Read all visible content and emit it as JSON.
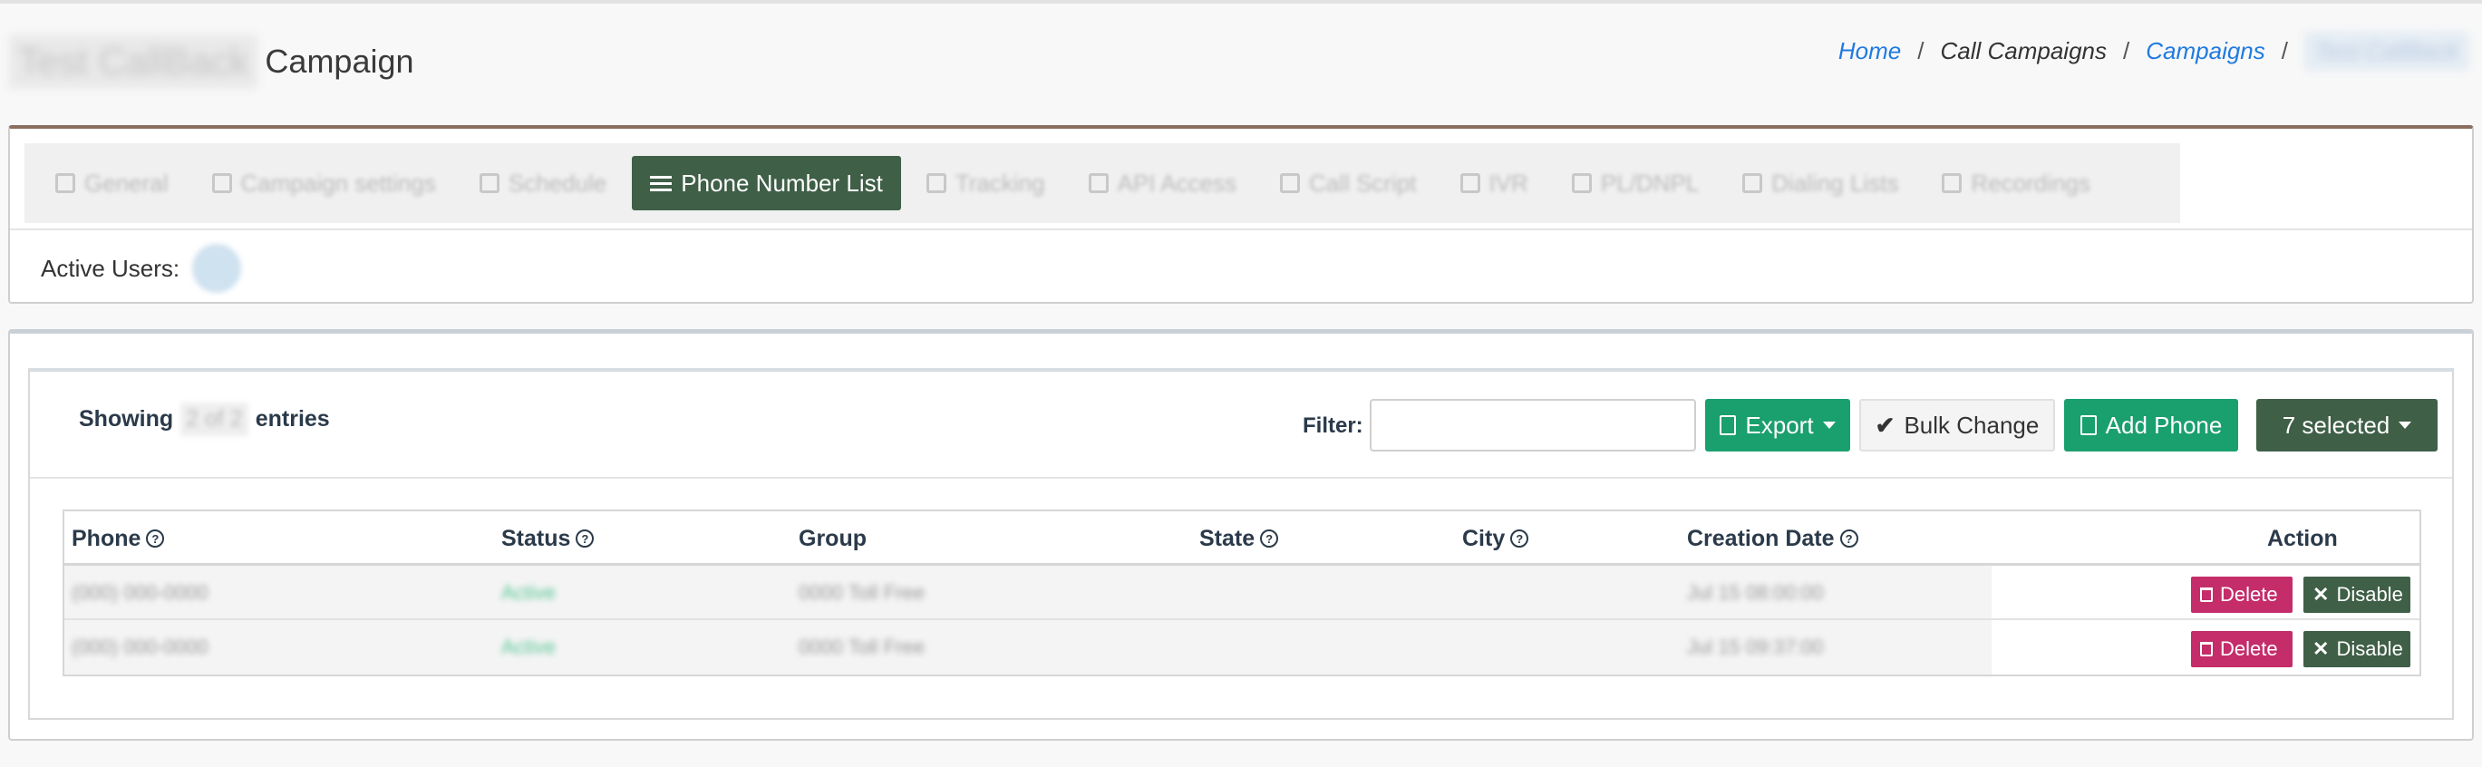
{
  "header": {
    "title_blurred": "Test CallBack",
    "title_suffix": "Campaign"
  },
  "breadcrumb": {
    "home": "Home",
    "call_campaigns": "Call Campaigns",
    "campaigns": "Campaigns",
    "current": "Test CallBack",
    "separator": "/"
  },
  "tabs": [
    {
      "label": "General",
      "icon": "gears-icon"
    },
    {
      "label": "Campaign settings",
      "icon": "gears-icon"
    },
    {
      "label": "Schedule",
      "icon": "calendar-icon"
    },
    {
      "label": "Phone Number List",
      "icon": "list-icon"
    },
    {
      "label": "Tracking",
      "icon": "gears-icon"
    },
    {
      "label": "API Access",
      "icon": "link-icon"
    },
    {
      "label": "Call Script",
      "icon": "refresh-icon"
    },
    {
      "label": "IVR",
      "icon": "ivr-icon"
    },
    {
      "label": "PL/DNPL",
      "icon": "clock-icon"
    },
    {
      "label": "Dialing Lists",
      "icon": "list-icon"
    },
    {
      "label": "Recordings",
      "icon": "list-icon"
    }
  ],
  "active_tab_index": 3,
  "active_users": {
    "label": "Active Users:"
  },
  "toolbar": {
    "showing_prefix": "Showing",
    "showing_count": "2 of 2",
    "showing_suffix": "entries",
    "filter_label": "Filter:",
    "filter_value": "",
    "export_label": "Export",
    "bulk_label": "Bulk Change",
    "add_label": "Add Phone",
    "selected_label": "7 selected"
  },
  "table": {
    "columns": [
      "Phone",
      "Status",
      "Group",
      "State",
      "City",
      "Creation Date",
      "Action"
    ],
    "rows": [
      {
        "phone": "(000) 000-0000",
        "status": "Active",
        "group": "0000 Toll Free",
        "state": "",
        "city": "",
        "created": "Jul 15 08:00:00"
      },
      {
        "phone": "(000) 000-0000",
        "status": "Active",
        "group": "0000 Toll Free",
        "state": "",
        "city": "",
        "created": "Jul 15 09:37:00"
      }
    ],
    "delete_label": "Delete",
    "disable_label": "Disable"
  },
  "colors": {
    "primary_green": "#1a9f6f",
    "dark_green": "#3f5f47",
    "delete_pink": "#c42d6a",
    "link_blue": "#1f7ae0"
  }
}
